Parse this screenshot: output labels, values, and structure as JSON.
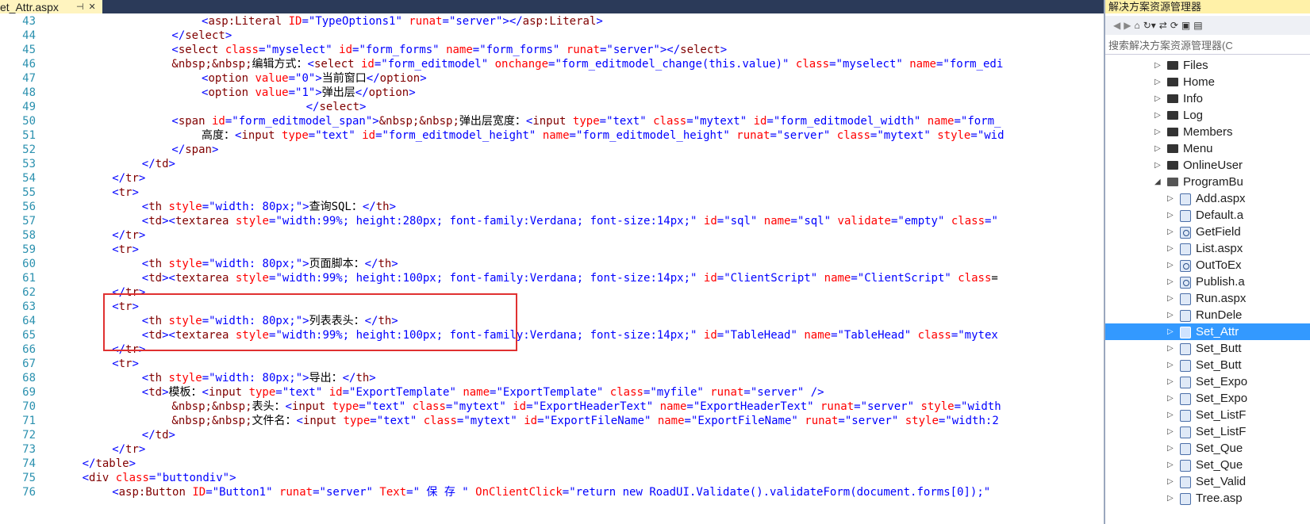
{
  "tab": {
    "title": "et_Attr.aspx",
    "pin_icon": "pin-icon",
    "close_icon": "close-icon"
  },
  "editor": {
    "lines": [
      {
        "n": "43",
        "t": "          <asp:Literal ID=\"TypeOptions1\" runat=\"server\"></asp:Literal>",
        "ind": 10
      },
      {
        "n": "44",
        "t": "</select>",
        "ind": 8
      },
      {
        "n": "45",
        "t": "<select class=\"myselect\" id=\"form_forms\" name=\"form_forms\" runat=\"server\"></select>",
        "ind": 8
      },
      {
        "n": "46",
        "t": "&nbsp;&nbsp;编辑方式：<select id=\"form_editmodel\" onchange=\"form_editmodel_change(this.value)\" class=\"myselect\" name=\"form_edi",
        "ind": 8
      },
      {
        "n": "47",
        "t": "<option value=\"0\">当前窗口</option>",
        "ind": 10
      },
      {
        "n": "48",
        "t": "<option value=\"1\">弹出层</option>",
        "ind": 10
      },
      {
        "n": "49",
        "t": "</select>",
        "ind": 17
      },
      {
        "n": "50",
        "t": "<span id=\"form_editmodel_span\">&nbsp;&nbsp;弹出层宽度：<input type=\"text\" class=\"mytext\" id=\"form_editmodel_width\" name=\"form_",
        "ind": 8
      },
      {
        "n": "51",
        "t": "高度：<input type=\"text\" id=\"form_editmodel_height\" name=\"form_editmodel_height\" runat=\"server\" class=\"mytext\" style=\"wid",
        "ind": 10
      },
      {
        "n": "52",
        "t": "</span>",
        "ind": 8
      },
      {
        "n": "53",
        "t": "</td>",
        "ind": 6
      },
      {
        "n": "54",
        "t": "</tr>",
        "ind": 4
      },
      {
        "n": "55",
        "t": "<tr>",
        "ind": 4
      },
      {
        "n": "56",
        "t": "<th style=\"width: 80px;\">查询SQL：</th>",
        "ind": 6
      },
      {
        "n": "57",
        "t": "<td><textarea style=\"width:99%; height:280px; font-family:Verdana; font-size:14px;\" id=\"sql\" name=\"sql\" validate=\"empty\" class=\"",
        "ind": 6
      },
      {
        "n": "58",
        "t": "</tr>",
        "ind": 4
      },
      {
        "n": "59",
        "t": "<tr>",
        "ind": 4
      },
      {
        "n": "60",
        "t": "<th style=\"width: 80px;\">页面脚本：</th>",
        "ind": 6
      },
      {
        "n": "61",
        "t": "<td><textarea style=\"width:99%; height:100px; font-family:Verdana; font-size:14px;\" id=\"ClientScript\" name=\"ClientScript\" class=",
        "ind": 6
      },
      {
        "n": "62",
        "t": "</tr>",
        "ind": 4
      },
      {
        "n": "63",
        "t": "<tr>",
        "ind": 4
      },
      {
        "n": "64",
        "t": "<th style=\"width: 80px;\">列表表头：</th>",
        "ind": 6
      },
      {
        "n": "65",
        "t": "<td><textarea style=\"width:99%; height:100px; font-family:Verdana; font-size:14px;\" id=\"TableHead\" name=\"TableHead\" class=\"mytex",
        "ind": 6
      },
      {
        "n": "66",
        "t": "</tr>",
        "ind": 4
      },
      {
        "n": "67",
        "t": "<tr>",
        "ind": 4
      },
      {
        "n": "68",
        "t": "<th style=\"width: 80px;\">导出：</th>",
        "ind": 6
      },
      {
        "n": "69",
        "t": "<td>模板：<input type=\"text\" id=\"ExportTemplate\" name=\"ExportTemplate\" class=\"myfile\" runat=\"server\" />",
        "ind": 6
      },
      {
        "n": "70",
        "t": "&nbsp;&nbsp;表头：<input type=\"text\" class=\"mytext\" id=\"ExportHeaderText\" name=\"ExportHeaderText\" runat=\"server\" style=\"width",
        "ind": 8
      },
      {
        "n": "71",
        "t": "&nbsp;&nbsp;文件名：<input type=\"text\" class=\"mytext\" id=\"ExportFileName\" name=\"ExportFileName\" runat=\"server\" style=\"width:2",
        "ind": 8
      },
      {
        "n": "72",
        "t": "</td>",
        "ind": 6
      },
      {
        "n": "73",
        "t": "</tr>",
        "ind": 4
      },
      {
        "n": "74",
        "t": "</table>",
        "ind": 2
      },
      {
        "n": "75",
        "t": "<div class=\"buttondiv\">",
        "ind": 2
      },
      {
        "n": "76",
        "t": "<asp:Button ID=\"Button1\" runat=\"server\" Text=\" 保 存 \" OnClientClick=\"return new RoadUI.Validate().validateForm(document.forms[0]);\"",
        "ind": 4
      }
    ]
  },
  "solution_explorer": {
    "title": "解决方案资源管理器",
    "search_placeholder": "搜索解决方案资源管理器(C",
    "items": [
      {
        "label": "Files",
        "kind": "folder",
        "level": 0,
        "arrow": "▷"
      },
      {
        "label": "Home",
        "kind": "folder",
        "level": 0,
        "arrow": "▷"
      },
      {
        "label": "Info",
        "kind": "folder",
        "level": 0,
        "arrow": "▷"
      },
      {
        "label": "Log",
        "kind": "folder",
        "level": 0,
        "arrow": "▷"
      },
      {
        "label": "Members",
        "kind": "folder",
        "level": 0,
        "arrow": "▷"
      },
      {
        "label": "Menu",
        "kind": "folder",
        "level": 0,
        "arrow": "▷"
      },
      {
        "label": "OnlineUser",
        "kind": "folder",
        "level": 0,
        "arrow": "▷"
      },
      {
        "label": "ProgramBu",
        "kind": "folder-open",
        "level": 0,
        "arrow": "◢"
      },
      {
        "label": "Add.aspx",
        "kind": "file",
        "level": 1,
        "arrow": "▷"
      },
      {
        "label": "Default.a",
        "kind": "file",
        "level": 1,
        "arrow": "▷"
      },
      {
        "label": "GetField",
        "kind": "glob",
        "level": 1,
        "arrow": "▷"
      },
      {
        "label": "List.aspx",
        "kind": "file",
        "level": 1,
        "arrow": "▷"
      },
      {
        "label": "OutToEx",
        "kind": "glob",
        "level": 1,
        "arrow": "▷"
      },
      {
        "label": "Publish.a",
        "kind": "glob",
        "level": 1,
        "arrow": "▷"
      },
      {
        "label": "Run.aspx",
        "kind": "file",
        "level": 1,
        "arrow": "▷"
      },
      {
        "label": "RunDele",
        "kind": "file",
        "level": 1,
        "arrow": "▷"
      },
      {
        "label": "Set_Attr",
        "kind": "file",
        "level": 1,
        "arrow": "▷",
        "selected": true
      },
      {
        "label": "Set_Butt",
        "kind": "file",
        "level": 1,
        "arrow": "▷"
      },
      {
        "label": "Set_Butt",
        "kind": "file",
        "level": 1,
        "arrow": "▷"
      },
      {
        "label": "Set_Expo",
        "kind": "file",
        "level": 1,
        "arrow": "▷"
      },
      {
        "label": "Set_Expo",
        "kind": "file",
        "level": 1,
        "arrow": "▷"
      },
      {
        "label": "Set_ListF",
        "kind": "file",
        "level": 1,
        "arrow": "▷"
      },
      {
        "label": "Set_ListF",
        "kind": "file",
        "level": 1,
        "arrow": "▷"
      },
      {
        "label": "Set_Que",
        "kind": "file",
        "level": 1,
        "arrow": "▷"
      },
      {
        "label": "Set_Que",
        "kind": "file",
        "level": 1,
        "arrow": "▷"
      },
      {
        "label": "Set_Valid",
        "kind": "file",
        "level": 1,
        "arrow": "▷"
      },
      {
        "label": "Tree.asp",
        "kind": "file",
        "level": 1,
        "arrow": "▷"
      }
    ]
  },
  "colors": {
    "tag": "#0000ff",
    "element": "#800000",
    "attr": "#ff0000",
    "value": "#0000ff",
    "line_number": "#2b91af",
    "highlight_box": "#e03131",
    "selected": "#3399ff"
  }
}
